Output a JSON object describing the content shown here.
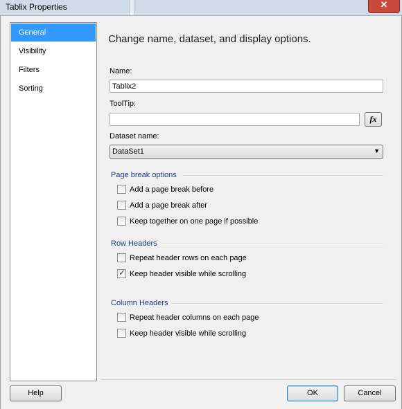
{
  "window": {
    "title": "Tablix Properties",
    "close_glyph": "✕"
  },
  "nav": {
    "items": [
      {
        "label": "General",
        "active": true
      },
      {
        "label": "Visibility",
        "active": false
      },
      {
        "label": "Filters",
        "active": false
      },
      {
        "label": "Sorting",
        "active": false
      }
    ]
  },
  "main": {
    "heading": "Change name, dataset, and display options.",
    "name_label": "Name:",
    "name_value": "Tablix2",
    "tooltip_label": "ToolTip:",
    "tooltip_value": "",
    "fx_label": "fx",
    "dataset_label": "Dataset name:",
    "dataset_value": "DataSet1",
    "page_break": {
      "title": "Page break options",
      "options": [
        {
          "label": "Add a page break before",
          "checked": false
        },
        {
          "label": "Add a page break after",
          "checked": false
        },
        {
          "label": "Keep together on one page if possible",
          "checked": false
        }
      ]
    },
    "row_headers": {
      "title": "Row Headers",
      "options": [
        {
          "label": "Repeat header rows on each page",
          "checked": false
        },
        {
          "label": "Keep header visible while scrolling",
          "checked": true
        }
      ]
    },
    "column_headers": {
      "title": "Column Headers",
      "options": [
        {
          "label": "Repeat header columns on each page",
          "checked": false
        },
        {
          "label": "Keep header visible while scrolling",
          "checked": false
        }
      ]
    }
  },
  "footer": {
    "help_label": "Help",
    "ok_label": "OK",
    "cancel_label": "Cancel"
  },
  "colors": {
    "selection": "#3399ff",
    "group_title": "#1c3d8a",
    "close_button": "#c94a3c"
  }
}
